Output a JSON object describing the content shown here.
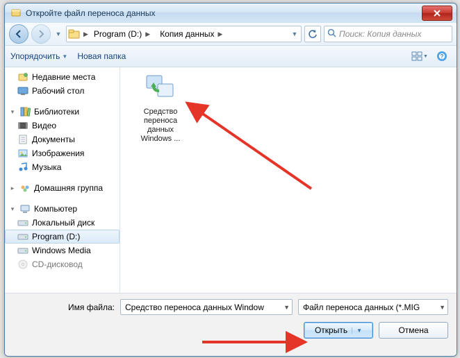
{
  "window": {
    "title": "Откройте файл переноса данных"
  },
  "nav": {
    "breadcrumb": [
      {
        "label": "Program (D:)"
      },
      {
        "label": "Копия данных"
      }
    ],
    "search_placeholder": "Поиск: Копия данных"
  },
  "toolbar": {
    "organize": "Упорядочить",
    "new_folder": "Новая папка"
  },
  "tree": {
    "favorites": [
      {
        "label": "Недавние места",
        "icon": "recent"
      },
      {
        "label": "Рабочий стол",
        "icon": "desktop"
      }
    ],
    "libraries_label": "Библиотеки",
    "libraries": [
      {
        "label": "Видео",
        "icon": "video"
      },
      {
        "label": "Документы",
        "icon": "docs"
      },
      {
        "label": "Изображения",
        "icon": "pics"
      },
      {
        "label": "Музыка",
        "icon": "music"
      }
    ],
    "homegroup_label": "Домашняя группа",
    "computer_label": "Компьютер",
    "drives": [
      {
        "label": "Локальный диск",
        "icon": "drive"
      },
      {
        "label": "Program (D:)",
        "icon": "drive",
        "selected": true
      },
      {
        "label": "Windows Media",
        "icon": "drive"
      },
      {
        "label": "CD-дисковод",
        "icon": "cd"
      }
    ]
  },
  "content": {
    "file_label": "Средство переноса данных Windows ..."
  },
  "footer": {
    "filename_label": "Имя файла:",
    "filename_value": "Средство переноса данных Window",
    "filter_value": "Файл переноса данных (*.MIG",
    "open": "Открыть",
    "cancel": "Отмена"
  }
}
